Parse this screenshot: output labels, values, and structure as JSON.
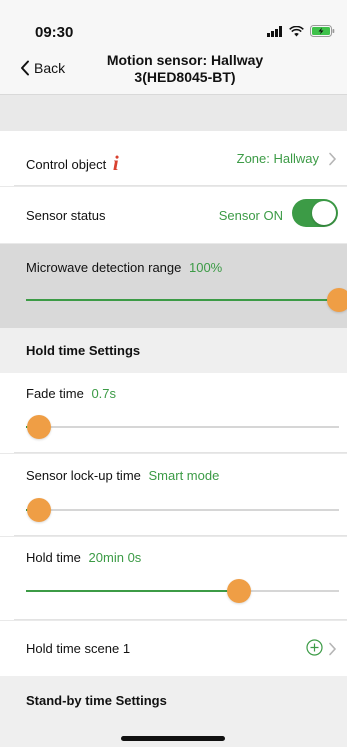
{
  "status": {
    "time": "09:30"
  },
  "nav": {
    "back_label": "Back",
    "title_line1": "Motion sensor: Hallway",
    "title_line2": "3(HED8045-BT)"
  },
  "control_object": {
    "label": "Control object",
    "info_glyph": "i",
    "value": "Zone: Hallway"
  },
  "sensor_status": {
    "label": "Sensor status",
    "value": "Sensor ON",
    "toggle_on": true
  },
  "microwave": {
    "label": "Microwave detection range",
    "value": "100%",
    "level_percent": 100
  },
  "hold_time_settings": {
    "title": "Hold time Settings"
  },
  "fade_time": {
    "label": "Fade time",
    "value": "0.7s",
    "level_percent": 4
  },
  "lockup_time": {
    "label": "Sensor lock-up time",
    "value": "Smart mode",
    "level_percent": 4
  },
  "hold_time": {
    "label": "Hold time",
    "value": "20min 0s",
    "level_percent": 68
  },
  "hold_scene": {
    "label": "Hold time scene 1"
  },
  "standby_settings": {
    "title": "Stand-by time Settings"
  },
  "colors": {
    "accent_green": "#3c9b46",
    "thumb_orange": "#ef9e45",
    "info_red": "#d8412f"
  }
}
